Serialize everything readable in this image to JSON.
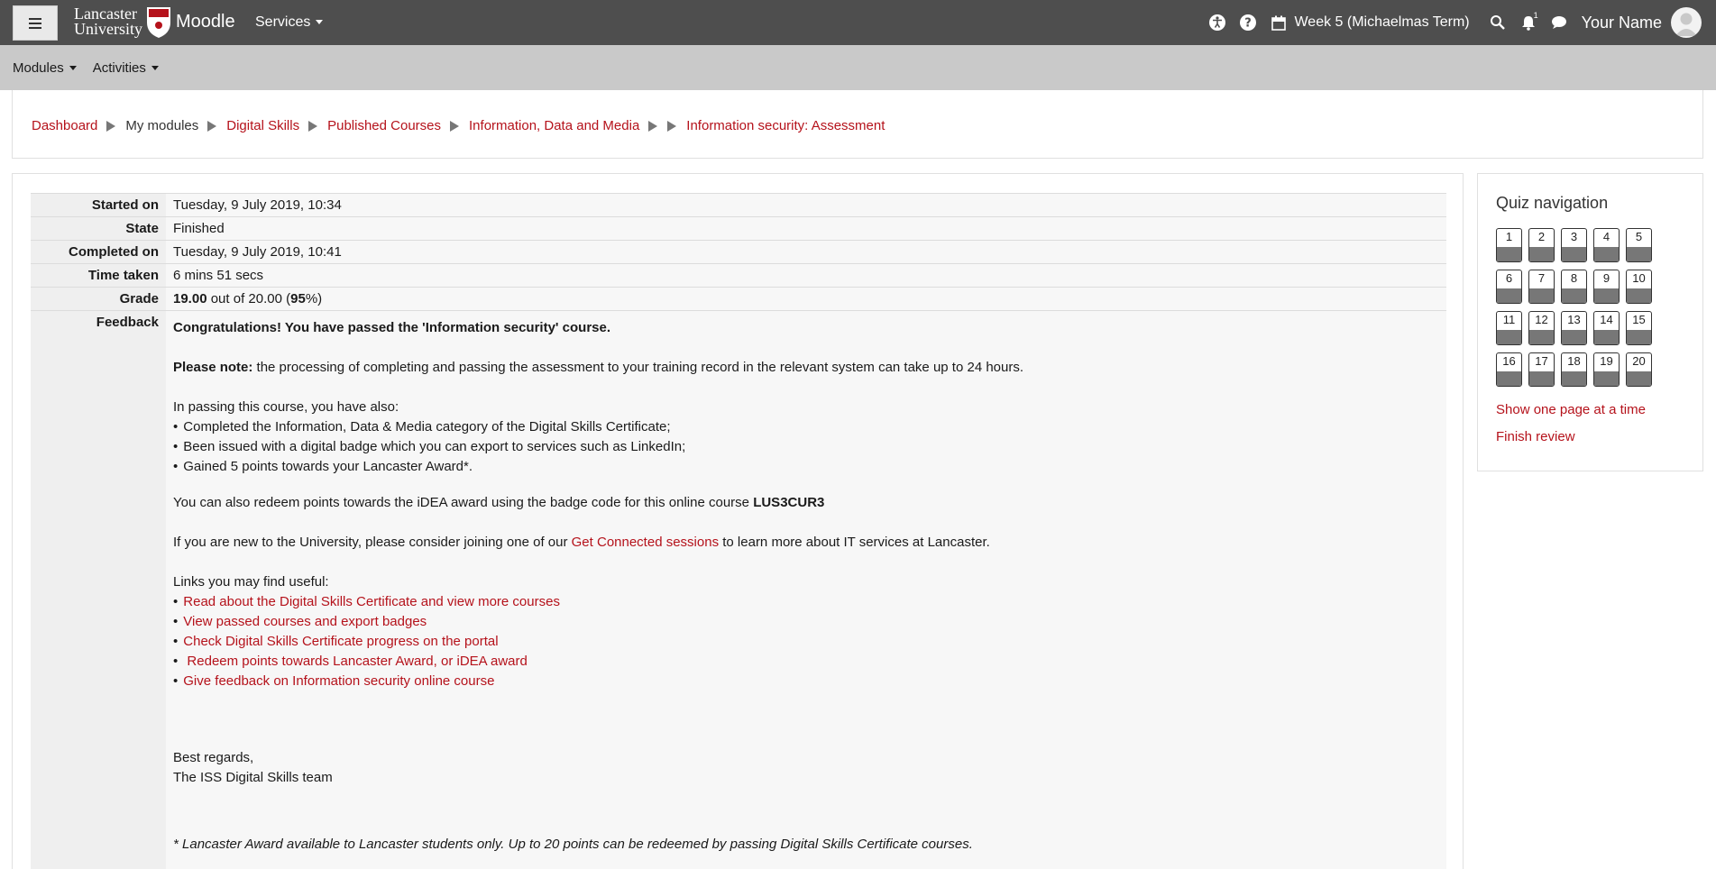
{
  "header": {
    "logo_text_line1": "Lancaster",
    "logo_text_line2": "University",
    "moodle_label": "Moodle",
    "services_label": "Services",
    "week_label": "Week 5 (Michaelmas Term)",
    "notification_count": "1",
    "user_name": "Your Name"
  },
  "subnav": {
    "modules_label": "Modules",
    "activities_label": "Activities"
  },
  "breadcrumb": {
    "items": [
      "Dashboard",
      "My modules",
      "Digital Skills",
      "Published Courses",
      "Information, Data and Media",
      "Information security: Assessment"
    ]
  },
  "summary": {
    "started_label": "Started on",
    "started_value": "Tuesday, 9 July 2019, 10:34",
    "state_label": "State",
    "state_value": "Finished",
    "completed_label": "Completed on",
    "completed_value": "Tuesday, 9 July 2019, 10:41",
    "time_label": "Time taken",
    "time_value": "6 mins 51 secs",
    "grade_label": "Grade",
    "grade_score": "19.00",
    "grade_middle": " out of 20.00 (",
    "grade_percent": "95",
    "grade_end": "%)",
    "feedback_label": "Feedback"
  },
  "feedback": {
    "congrats": "Congratulations! You have passed the 'Information security' course.",
    "note_bold": "Please note:",
    "note_text": " the processing of completing and passing the assessment to your training record in the relevant system can take up to 24 hours.",
    "passing_intro": "In passing this course, you have also:",
    "passing_items": [
      "Completed the Information, Data & Media category of the Digital Skills Certificate;",
      "Been issued with a digital badge which you can export to services such as LinkedIn;",
      "Gained 5 points towards your Lancaster Award*."
    ],
    "redeem_text": "You can also redeem points towards the iDEA award using the badge code for this online course ",
    "badge_code": "LUS3CUR3",
    "new_text_before": "If you are new to the University, please consider joining one of our ",
    "new_link": "Get Connected sessions",
    "new_text_after": " to learn more about IT services at Lancaster.",
    "links_intro": "Links you may find useful:",
    "links": [
      "Read about the Digital Skills Certificate and view more courses",
      "View passed courses and export badges",
      "Check Digital Skills Certificate progress on the portal",
      " Redeem points towards Lancaster Award, or iDEA award",
      "Give feedback on Information security online course"
    ],
    "regards": "Best regards,",
    "team": "The ISS Digital Skills team",
    "footnote": "* Lancaster Award available to Lancaster students only. Up to 20 points can be redeemed by passing Digital Skills Certificate courses."
  },
  "quiz_nav": {
    "title": "Quiz navigation",
    "questions": [
      "1",
      "2",
      "3",
      "4",
      "5",
      "6",
      "7",
      "8",
      "9",
      "10",
      "11",
      "12",
      "13",
      "14",
      "15",
      "16",
      "17",
      "18",
      "19",
      "20"
    ],
    "show_one_page": "Show one page at a time",
    "finish_review": "Finish review"
  },
  "colors": {
    "topbar": "#4e4e4e",
    "subbar": "#c9c9c9",
    "link": "#b5121b"
  }
}
